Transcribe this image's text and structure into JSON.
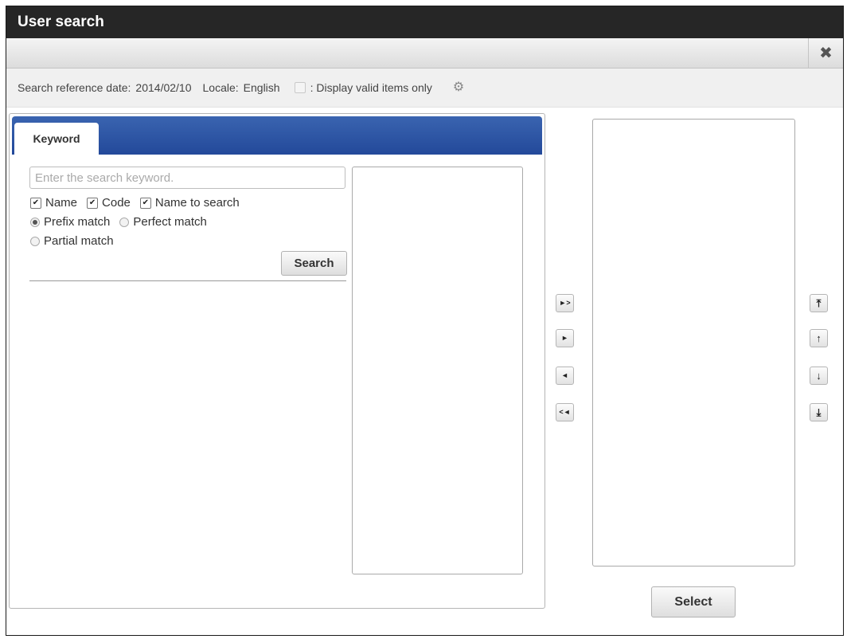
{
  "window": {
    "title": "User search"
  },
  "toolbar": {
    "close_icon": "close-icon"
  },
  "info": {
    "ref_date_label": "Search reference date:",
    "ref_date_value": "2014/02/10",
    "locale_label": "Locale:",
    "locale_value": "English",
    "valid_only_label": ": Display valid items only",
    "valid_only_checked": false,
    "settings_icon": "gear-icon"
  },
  "tabs": [
    {
      "label": "Keyword",
      "active": true
    }
  ],
  "search": {
    "placeholder": "Enter the search keyword.",
    "value": "",
    "checkboxes": [
      {
        "label": "Name",
        "checked": true
      },
      {
        "label": "Code",
        "checked": true
      },
      {
        "label": "Name to search",
        "checked": true
      }
    ],
    "match_options": [
      {
        "label": "Prefix match",
        "selected": true
      },
      {
        "label": "Perfect match",
        "selected": false
      },
      {
        "label": "Partial match",
        "selected": false
      }
    ],
    "button_label": "Search"
  },
  "transfer_buttons": [
    {
      "name": "add-all-button",
      "glyph": "►>"
    },
    {
      "name": "add-button",
      "glyph": "►"
    },
    {
      "name": "remove-button",
      "glyph": "◄"
    },
    {
      "name": "remove-all-button",
      "glyph": "<◄"
    }
  ],
  "order_buttons": [
    {
      "name": "move-top-button",
      "glyph": "⤒"
    },
    {
      "name": "move-up-button",
      "glyph": "↑"
    },
    {
      "name": "move-down-button",
      "glyph": "↓"
    },
    {
      "name": "move-bottom-button",
      "glyph": "⤓"
    }
  ],
  "footer": {
    "select_label": "Select"
  }
}
